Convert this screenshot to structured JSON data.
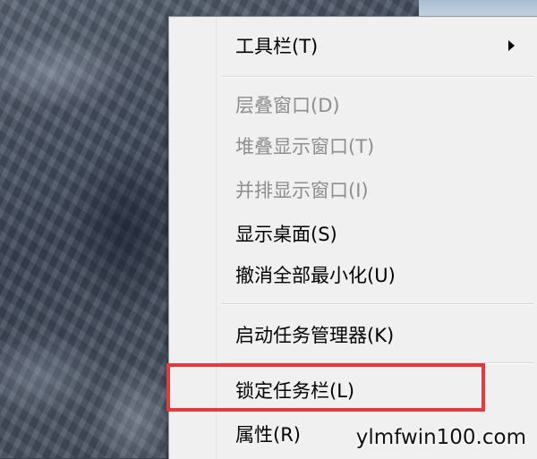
{
  "context_menu": {
    "items": [
      {
        "label": "工具栏(T)",
        "enabled": true,
        "has_submenu": true
      },
      {
        "label": "层叠窗口(D)",
        "enabled": false
      },
      {
        "label": "堆叠显示窗口(T)",
        "enabled": false
      },
      {
        "label": "并排显示窗口(I)",
        "enabled": false
      },
      {
        "label": "显示桌面(S)",
        "enabled": true
      },
      {
        "label": "撤消全部最小化(U)",
        "enabled": true
      },
      {
        "label": "启动任务管理器(K)",
        "enabled": true
      },
      {
        "label": "锁定任务栏(L)",
        "enabled": true,
        "highlighted": true
      },
      {
        "label": "属性(R)",
        "enabled": true
      }
    ]
  },
  "annotation": {
    "highlight_color": "#e53a3a"
  },
  "watermark": {
    "text": "ylmfwin100.com"
  }
}
